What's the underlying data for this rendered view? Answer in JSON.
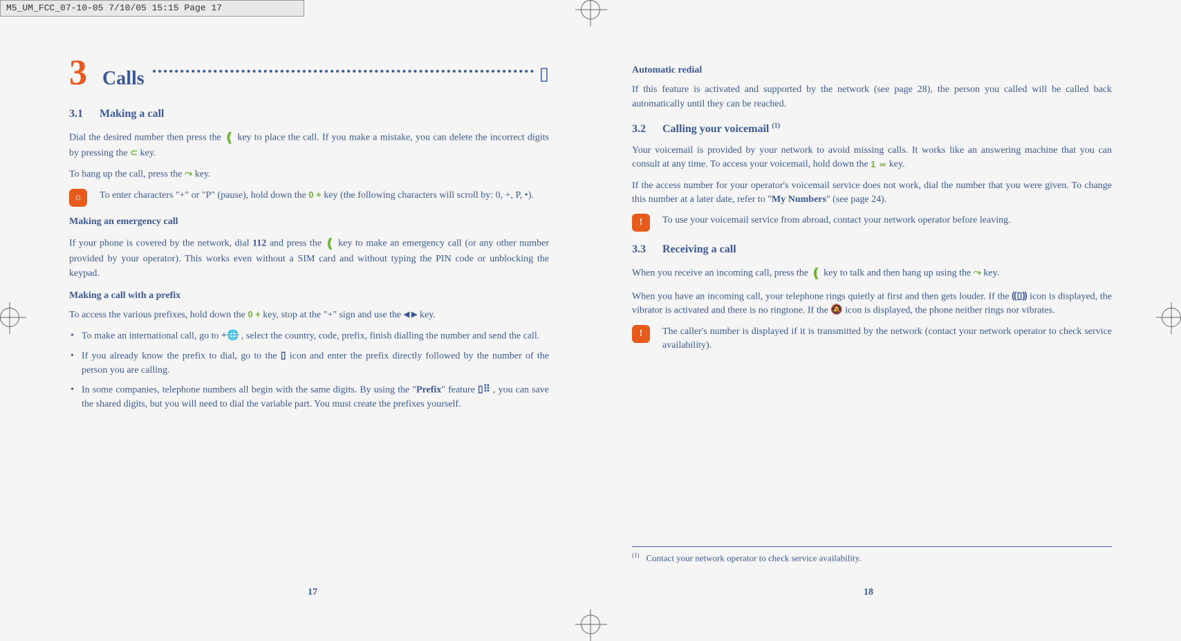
{
  "header": "M5_UM_FCC_07-10-05  7/10/05  15:15  Page 17",
  "chapter": {
    "num": "3",
    "title": "Calls"
  },
  "left": {
    "s31": {
      "num": "3.1",
      "title": "Making a call"
    },
    "p1a": "Dial the desired number then press the ",
    "p1b": " key to place the call. If you make a mistake, you can delete the incorrect digits by pressing the ",
    "p1c": " key.",
    "p2a": "To hang up the call, press the ",
    "p2b": " key.",
    "tip1a": "To enter characters \"+\" or \"P\" (pause), hold down the ",
    "tip1b": " key (the following characters will scroll by: 0, +, P, •).",
    "sub1": "Making an emergency call",
    "p3a": "If your phone is covered by the network, dial ",
    "p3b": "112",
    "p3c": " and press the ",
    "p3d": " key to make an emergency call (or any other number provided by your operator). This works even without a SIM card and without typing the PIN code or unblocking the keypad.",
    "sub2": "Making a call with a prefix",
    "p4a": "To access the various prefixes, hold down the ",
    "p4b": " key, stop at the \"+\" sign and use the ",
    "p4c": " key.",
    "li1a": "To make an international call, go to ",
    "li1b": " , select the country, code, prefix, finish dialling the number and send the call.",
    "li2a": "If you already know the prefix to dial, go to the ",
    "li2b": " icon and enter the prefix directly followed by the number of the person you are calling.",
    "li3a": "In some companies, telephone numbers all begin with the same digits. By using the \"",
    "li3b": "Prefix",
    "li3c": "\" feature ",
    "li3d": " , you can save the shared digits, but you will need to dial the variable part. You must create the prefixes yourself.",
    "pagenum": "17"
  },
  "right": {
    "sub1": "Automatic redial",
    "p1": "If this feature is activated and supported by the network (see page 28), the person you called will be called back automatically until they can be reached.",
    "s32": {
      "num": "3.2",
      "title": "Calling your voicemail ",
      "sup": "(1)"
    },
    "p2a": "Your voicemail is provided by your network to avoid missing calls. It works like an answering machine that you can consult at any time. To access your voicemail, hold down the ",
    "p2b": " key.",
    "p3a": "If the access number for your operator's voicemail service does not work, dial the number that you were given. To change this number at a later date, refer to \"",
    "p3b": "My Numbers",
    "p3c": "\" (see page 24).",
    "warn1": "To use your voicemail service from abroad, contact your network operator before leaving.",
    "s33": {
      "num": "3.3",
      "title": "Receiving a call"
    },
    "p4a": "When you receive an incoming call, press the ",
    "p4b": " key to talk and then hang up using the ",
    "p4c": " key.",
    "p5a": "When you have an incoming call, your telephone rings quietly at first and then gets louder. If the ",
    "p5b": " icon is displayed, the vibrator is activated and there is no ringtone. If the ",
    "p5c": " icon is displayed, the phone neither rings nor vibrates.",
    "warn2": "The caller's number is displayed if it is transmitted by the network (contact your network operator to check service availability).",
    "footnote": {
      "sup": "(1)",
      "text": "Contact your network operator to check service availability."
    },
    "pagenum": "18"
  },
  "icons": {
    "call": "❪",
    "back": "⊂",
    "hang": "⤳",
    "zero": "0 +",
    "nav": "◀ ▶",
    "globe": "+🌐",
    "phone": "▯",
    "prefix": "▯⠿",
    "vm": "1 ∞",
    "vibrate": "⸨▯⸩",
    "silence": "🔕",
    "tip": "☼",
    "warn": "!"
  }
}
